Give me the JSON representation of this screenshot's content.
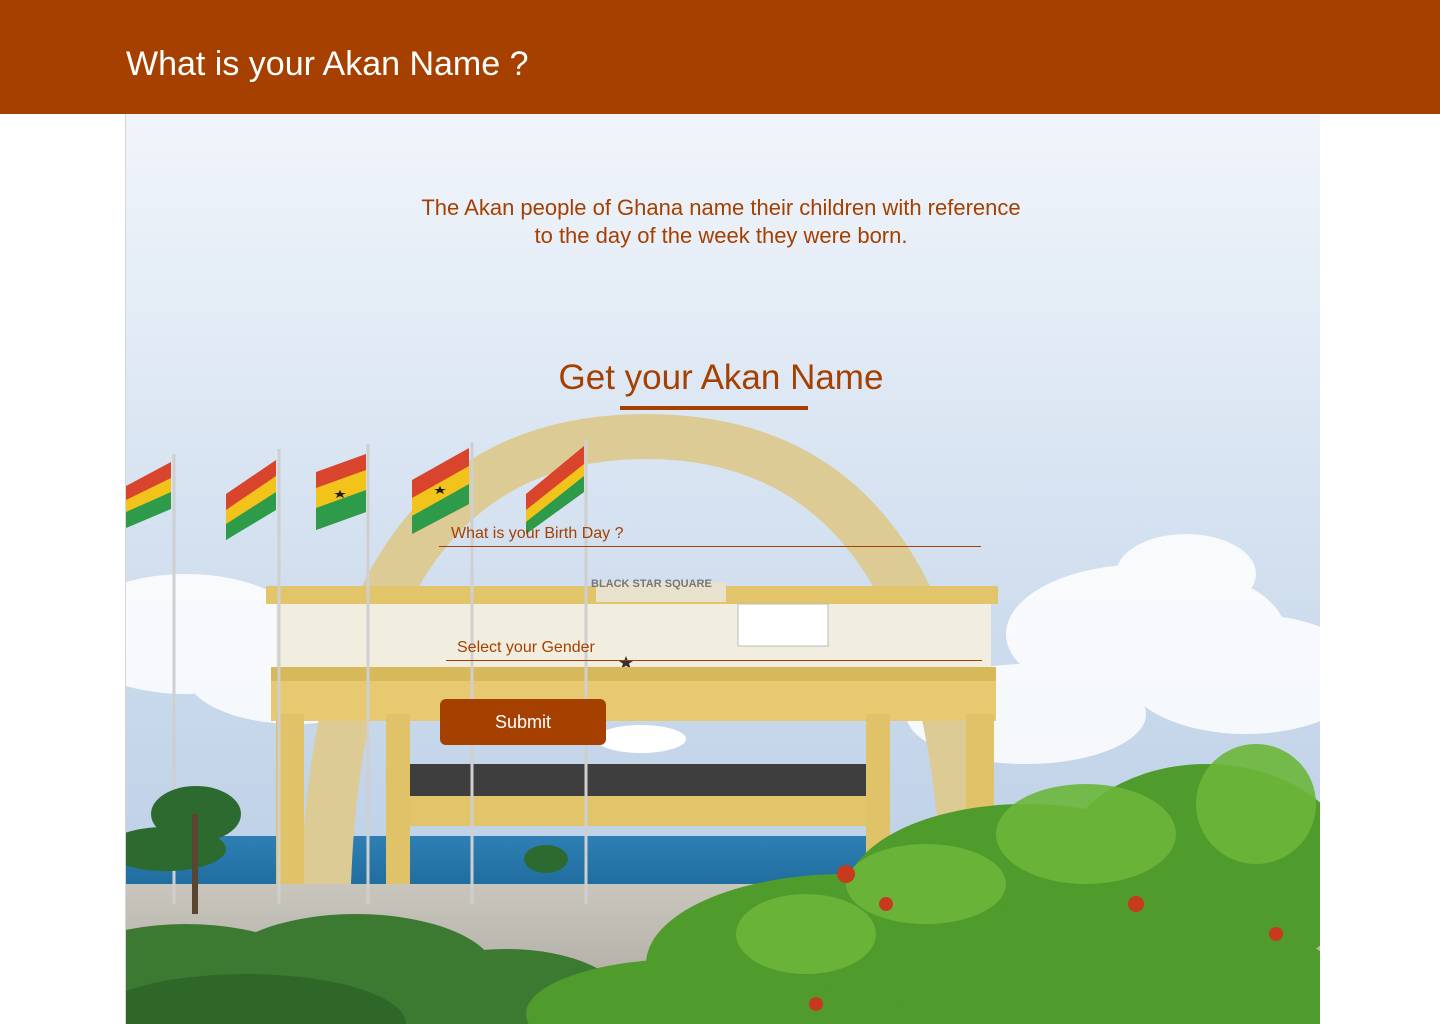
{
  "header": {
    "title": "What is your Akan Name ?"
  },
  "intro": {
    "line1": "The Akan people of Ghana name their children with reference",
    "line2": "to the day of the week they were born."
  },
  "form": {
    "title": "Get your Akan Name",
    "birthday_placeholder": "What is your Birth Day ?",
    "gender_placeholder": "Select your Gender",
    "submit_label": "Submit"
  },
  "hero_image": {
    "sign_text": "BLACK STAR SQUARE"
  },
  "colors": {
    "brand": "#a54000",
    "header_text": "#ffffff",
    "button_text": "#ffffff"
  }
}
